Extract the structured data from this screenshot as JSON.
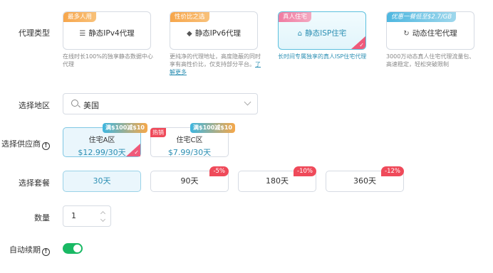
{
  "proxy_type": {
    "label": "代理类型",
    "cards": [
      {
        "tag": "最多人用",
        "icon": "server-icon",
        "name": "静态IPv4代理",
        "desc": "在线时长100%的独享静态数据中心代理",
        "active": false
      },
      {
        "tag": "性价比之选",
        "icon": "layers-icon",
        "name": "静态IPv6代理",
        "desc": "更纯净的代理地址，高度隐蔽的同时享有高性价比，仅支持部分平台。",
        "link": "了解更多",
        "active": false
      },
      {
        "tag": "真人住宅",
        "icon": "home-icon",
        "name": "静态ISP住宅",
        "desc": "长时间专属独享的真人ISP住宅代理",
        "active": true
      },
      {
        "tag": "优惠一餐低至$2.7/GB",
        "icon": "refresh-icon",
        "name": "动态住宅代理",
        "desc": "3000万动态真人住宅代理流量包、高速稳定，轻松突破限制",
        "active": false
      }
    ]
  },
  "region": {
    "label": "选择地区",
    "value": "美国"
  },
  "supplier": {
    "label": "选择供应商",
    "items": [
      {
        "name": "住宅A区",
        "price": "$12.99/30天",
        "promo": "满$100减$10",
        "hot": "",
        "active": true
      },
      {
        "name": "住宅C区",
        "price": "$7.99/30天",
        "promo": "满$100减$10",
        "hot": "热销",
        "active": false
      }
    ]
  },
  "package": {
    "label": "选择套餐",
    "items": [
      {
        "name": "30天",
        "discount": "",
        "active": true
      },
      {
        "name": "90天",
        "discount": "-5%",
        "active": false
      },
      {
        "name": "180天",
        "discount": "-10%",
        "active": false
      },
      {
        "name": "360天",
        "discount": "-12%",
        "active": false
      }
    ]
  },
  "quantity": {
    "label": "数量",
    "value": "1"
  },
  "auto_renew": {
    "label": "自动续期",
    "enabled": true
  },
  "help_glyph": "!",
  "check_glyph": "✓",
  "colors": {
    "accent": "#2c8fb3",
    "toggle_on": "#19b964",
    "discount": "#ef4a5a",
    "selected_corner": "#ef5a7a"
  }
}
